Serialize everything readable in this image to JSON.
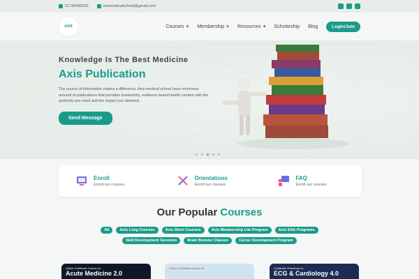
{
  "topbar": {
    "phone": "01730495315",
    "email": "axismedicalschool@gmail.com"
  },
  "header": {
    "logo_text": "AXIS",
    "nav": {
      "courses": "Courses",
      "membership": "Membership",
      "resources": "Resources",
      "scholarship": "Scholarship",
      "blog": "Blog",
      "plus": "+"
    },
    "login_label": "Login/Join"
  },
  "hero": {
    "tagline": "Knowledge Is The Best Medicine",
    "title": "Axis Publication",
    "description": "The source of information makes a difference. Axis medical school have enormous amount of publications that provides trustworthy, evidence based health content with the authority you need and the impact you demand.",
    "button_label": "Send Message",
    "carousel_active_index": 2
  },
  "features": [
    {
      "title": "Enroll",
      "subtitle": "Enroll our courses",
      "icon": "enroll-icon"
    },
    {
      "title": "Orientations",
      "subtitle": "Enroll our courses",
      "icon": "orientation-icon"
    },
    {
      "title": "FAQ",
      "subtitle": "Enroll our courses",
      "icon": "faq-icon"
    }
  ],
  "popular": {
    "title_part1": "Our Popular",
    "title_part2": "Courses",
    "chips": [
      "All",
      "Axis Long Courses",
      "Axis Short Courses",
      "Axis Membership Lite Program",
      "Axis Elite Programs",
      "Skill Development Sessions",
      "Brain Booster Classes",
      "Career Development Program"
    ]
  },
  "cards": [
    {
      "small": "Online Certificate Course on",
      "big": "Acute Medicine 2.0"
    },
    {
      "small": "Online Certificate Course on",
      "big": ""
    },
    {
      "small": "Certificate Workshop on",
      "big": "ECG & Cardiology 4.0"
    }
  ],
  "colors": {
    "accent": "#1a9b8a",
    "background": "#f4f7f5"
  }
}
